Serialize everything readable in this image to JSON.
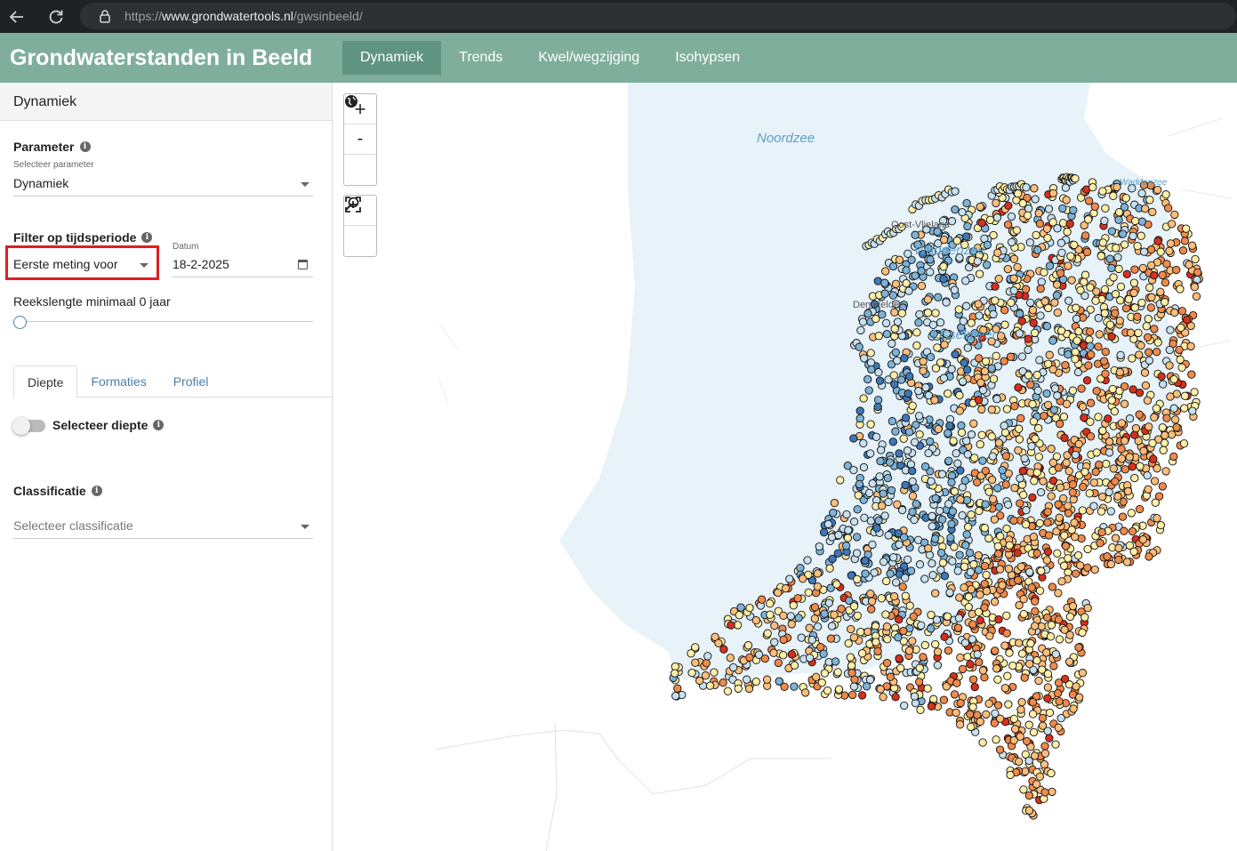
{
  "browser": {
    "url_prefix": "https://",
    "url_domain": "www.grondwatertools.nl",
    "url_path": "/gwsinbeeld/"
  },
  "app": {
    "title": "Grondwaterstanden in Beeld",
    "tabs": [
      {
        "label": "Dynamiek",
        "active": true
      },
      {
        "label": "Trends",
        "active": false
      },
      {
        "label": "Kwel/wegzijging",
        "active": false
      },
      {
        "label": "Isohypsen",
        "active": false
      }
    ]
  },
  "sidebar": {
    "header": "Dynamiek",
    "parameter": {
      "label": "Parameter",
      "sublabel": "Selecteer parameter",
      "value": "Dynamiek"
    },
    "period": {
      "label": "Filter op tijdsperiode",
      "value": "Eerste meting voor",
      "date_label": "Datum",
      "date_value": "18-2-2025"
    },
    "series_length": {
      "label": "Reekslengte minimaal 0 jaar",
      "value": 0
    },
    "subtabs": [
      {
        "label": "Diepte",
        "active": true
      },
      {
        "label": "Formaties",
        "active": false
      },
      {
        "label": "Profiel",
        "active": false
      }
    ],
    "depth_toggle": {
      "label": "Selecteer diepte",
      "on": false
    },
    "classification": {
      "label": "Classificatie",
      "placeholder": "Selecteer classificatie"
    }
  },
  "map": {
    "controls": {
      "zoom_in": "+",
      "zoom_out": "-"
    },
    "sea_labels": {
      "noordzee": "Noordzee",
      "waddenzee": "Waddenzee",
      "waddenzee_small": "Waddenzee",
      "ijsselmeer": "IJsselmeer"
    },
    "place_labels": {
      "oost_vlieland": "Oost-Vlieland",
      "den_helder": "Den Helder"
    },
    "colors": {
      "sea": "#e7f2f9",
      "red": "#d7301f",
      "orange": "#f08a4b",
      "light_orange": "#fdbe7a",
      "yellow": "#ffefa8",
      "light_blue": "#c7e1ef",
      "blue": "#7eb3d8",
      "dark_blue": "#3f78b8"
    }
  }
}
